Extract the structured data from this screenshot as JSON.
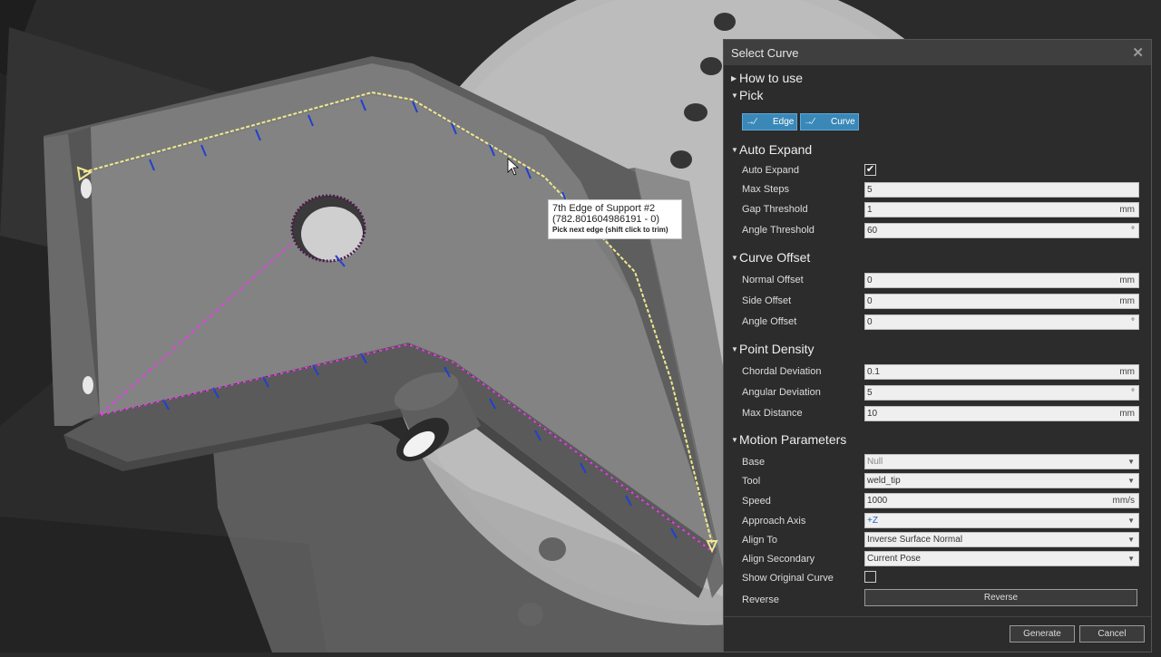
{
  "viewport": {
    "tooltip": {
      "line1": "7th Edge of Support #2",
      "line2": "(782.801604986191 - 0)",
      "line3": "Pick next edge (shift click to trim)"
    }
  },
  "panel": {
    "title": "Select Curve",
    "sections": {
      "how_to_use": "How to use",
      "pick": "Pick",
      "auto_expand": "Auto Expand",
      "curve_offset": "Curve Offset",
      "point_density": "Point Density",
      "motion_parameters": "Motion Parameters"
    },
    "pick": {
      "edge_label": "Edge",
      "curve_label": "Curve"
    },
    "auto_expand": {
      "auto_expand_label": "Auto Expand",
      "auto_expand_checked": true,
      "max_steps_label": "Max Steps",
      "max_steps_value": "5",
      "gap_threshold_label": "Gap Threshold",
      "gap_threshold_value": "1",
      "gap_threshold_unit": "mm",
      "angle_threshold_label": "Angle Threshold",
      "angle_threshold_value": "60",
      "angle_threshold_unit": "°"
    },
    "curve_offset": {
      "normal_offset_label": "Normal Offset",
      "normal_offset_value": "0",
      "normal_offset_unit": "mm",
      "side_offset_label": "Side Offset",
      "side_offset_value": "0",
      "side_offset_unit": "mm",
      "angle_offset_label": "Angle Offset",
      "angle_offset_value": "0",
      "angle_offset_unit": "°"
    },
    "point_density": {
      "chordal_label": "Chordal Deviation",
      "chordal_value": "0.1",
      "chordal_unit": "mm",
      "angular_label": "Angular Deviation",
      "angular_value": "5",
      "angular_unit": "°",
      "max_distance_label": "Max Distance",
      "max_distance_value": "10",
      "max_distance_unit": "mm"
    },
    "motion": {
      "base_label": "Base",
      "base_value": "Null",
      "tool_label": "Tool",
      "tool_value": "weld_tip",
      "speed_label": "Speed",
      "speed_value": "1000",
      "speed_unit": "mm/s",
      "approach_axis_label": "Approach Axis",
      "approach_axis_value": "+Z",
      "align_to_label": "Align To",
      "align_to_value": "Inverse Surface Normal",
      "align_secondary_label": "Align Secondary",
      "align_secondary_value": "Current Pose",
      "show_original_label": "Show Original Curve",
      "show_original_checked": false,
      "reverse_label": "Reverse",
      "reverse_button": "Reverse"
    },
    "footer": {
      "generate": "Generate",
      "cancel": "Cancel"
    }
  },
  "colors": {
    "accent_button": "#3a88b8",
    "curve_yellow": "#f0e890",
    "curve_magenta": "#e040e0",
    "normal_blue": "#2040d0"
  }
}
